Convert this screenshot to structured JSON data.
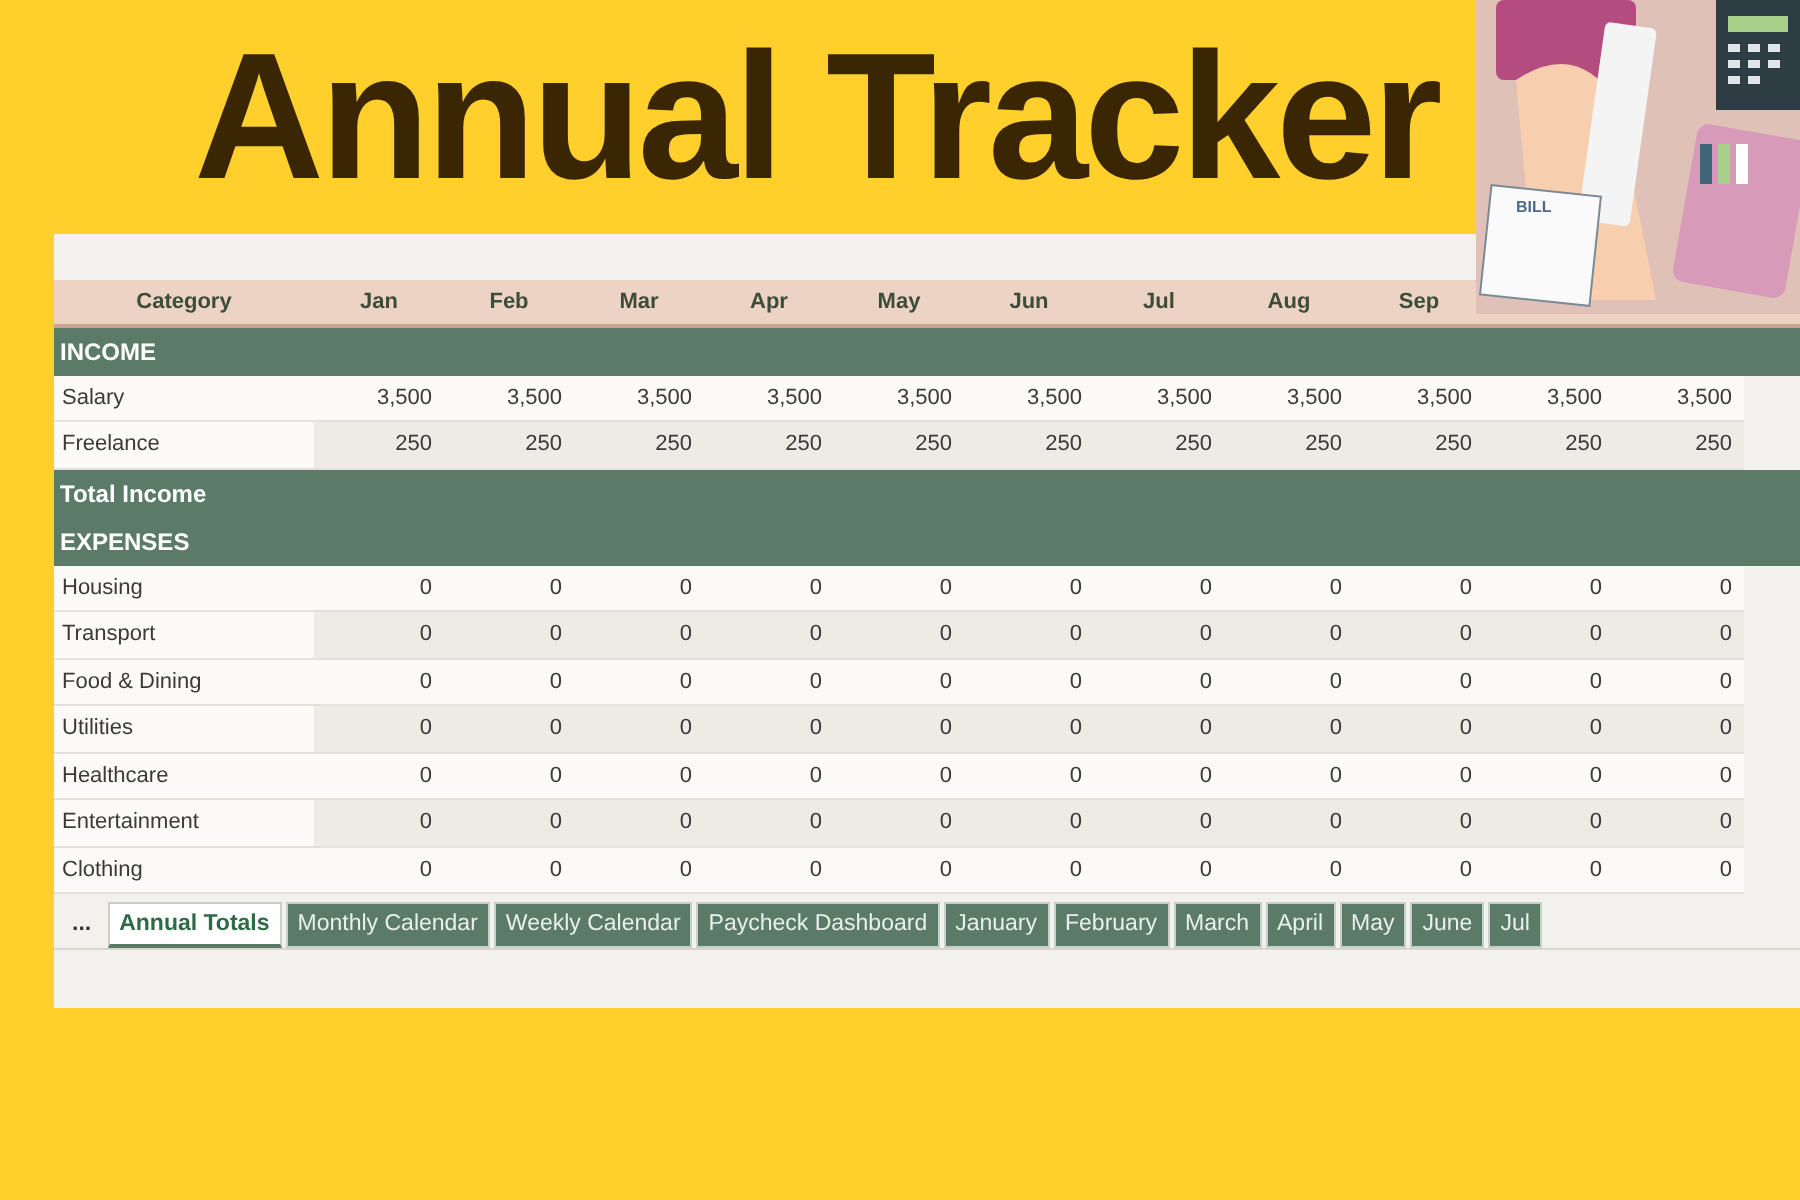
{
  "title": "Annual Tracker",
  "illustration": {
    "bill_label": "BILL"
  },
  "table": {
    "columns": [
      "Category",
      "Jan",
      "Feb",
      "Mar",
      "Apr",
      "May",
      "Jun",
      "Jul",
      "Aug",
      "Sep"
    ],
    "rows": [
      {
        "kind": "section",
        "label": "INCOME"
      },
      {
        "kind": "data",
        "label": "Salary",
        "values": [
          "3,500",
          "3,500",
          "3,500",
          "3,500",
          "3,500",
          "3,500",
          "3,500",
          "3,500",
          "3,500",
          "3,500",
          "3,500"
        ]
      },
      {
        "kind": "data",
        "label": "Freelance",
        "values": [
          "250",
          "250",
          "250",
          "250",
          "250",
          "250",
          "250",
          "250",
          "250",
          "250",
          "250"
        ]
      },
      {
        "kind": "total",
        "label": "Total Income"
      },
      {
        "kind": "section",
        "label": "EXPENSES"
      },
      {
        "kind": "data",
        "label": "Housing",
        "values": [
          "0",
          "0",
          "0",
          "0",
          "0",
          "0",
          "0",
          "0",
          "0",
          "0",
          "0"
        ]
      },
      {
        "kind": "data",
        "label": "Transport",
        "values": [
          "0",
          "0",
          "0",
          "0",
          "0",
          "0",
          "0",
          "0",
          "0",
          "0",
          "0"
        ]
      },
      {
        "kind": "data",
        "label": "Food & Dining",
        "values": [
          "0",
          "0",
          "0",
          "0",
          "0",
          "0",
          "0",
          "0",
          "0",
          "0",
          "0"
        ]
      },
      {
        "kind": "data",
        "label": "Utilities",
        "values": [
          "0",
          "0",
          "0",
          "0",
          "0",
          "0",
          "0",
          "0",
          "0",
          "0",
          "0"
        ]
      },
      {
        "kind": "data",
        "label": "Healthcare",
        "values": [
          "0",
          "0",
          "0",
          "0",
          "0",
          "0",
          "0",
          "0",
          "0",
          "0",
          "0"
        ]
      },
      {
        "kind": "data",
        "label": "Entertainment",
        "values": [
          "0",
          "0",
          "0",
          "0",
          "0",
          "0",
          "0",
          "0",
          "0",
          "0",
          "0"
        ]
      },
      {
        "kind": "data",
        "label": "Clothing",
        "values": [
          "0",
          "0",
          "0",
          "0",
          "0",
          "0",
          "0",
          "0",
          "0",
          "0",
          "0"
        ]
      }
    ]
  },
  "sheet_tabs": [
    {
      "label": "...",
      "selected": false
    },
    {
      "label": "Annual Totals",
      "selected": true
    },
    {
      "label": "Monthly Calendar",
      "selected": false
    },
    {
      "label": "Weekly Calendar",
      "selected": false
    },
    {
      "label": "Paycheck Dashboard",
      "selected": false
    },
    {
      "label": "January",
      "selected": false
    },
    {
      "label": "February",
      "selected": false
    },
    {
      "label": "March",
      "selected": false
    },
    {
      "label": "April",
      "selected": false
    },
    {
      "label": "May",
      "selected": false
    },
    {
      "label": "June",
      "selected": false
    },
    {
      "label": "Jul",
      "selected": false
    }
  ]
}
